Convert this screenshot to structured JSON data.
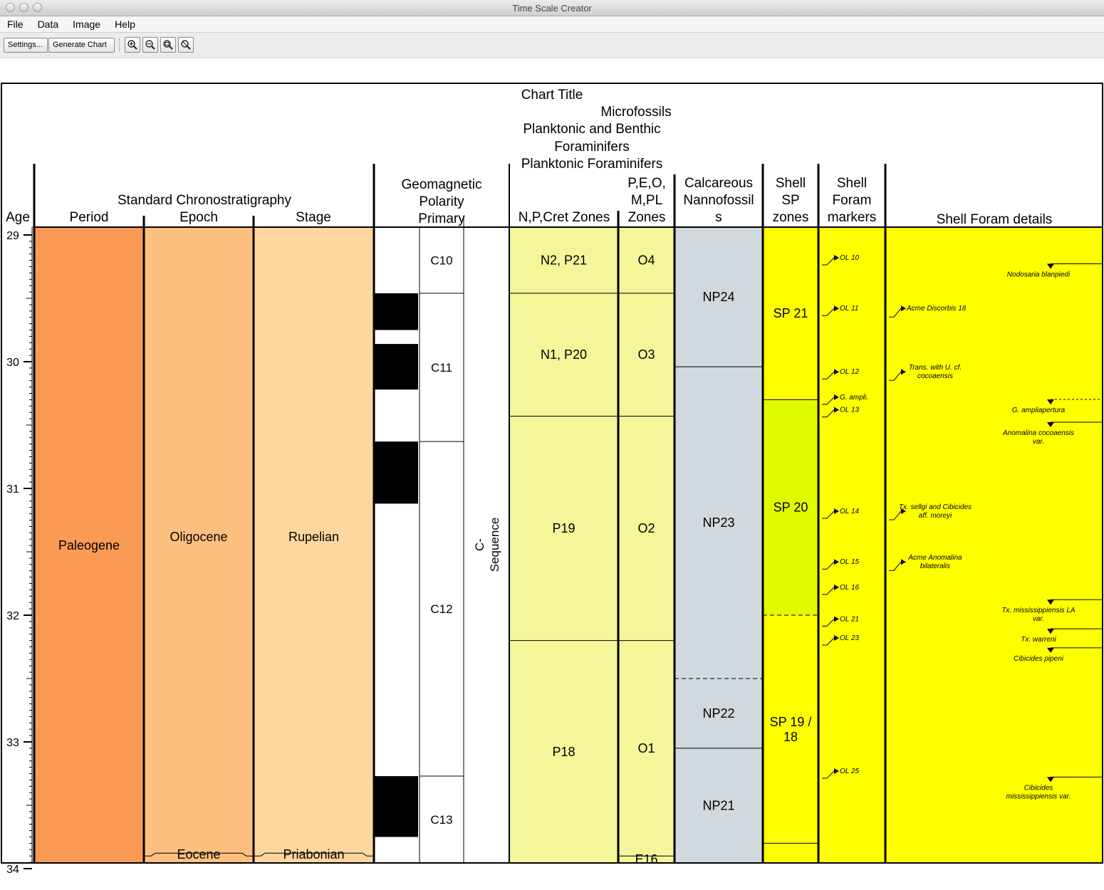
{
  "window": {
    "title": "Time Scale Creator"
  },
  "menu": {
    "items": [
      "File",
      "Data",
      "Image",
      "Help"
    ]
  },
  "toolbar": {
    "settings_label": "Settings...",
    "generate_label": "Generate Chart",
    "icons": [
      "zoom-in-icon",
      "zoom-out-icon",
      "zoom-actual-icon",
      "zoom-fit-icon"
    ]
  },
  "colors": {
    "period": "#FB9A55",
    "epoch": "#FDC07E",
    "stage": "#FDD79E",
    "zones": "#F5F59A",
    "nanno": "#D1D8DE",
    "shell": "#FFFF00",
    "sp20": "#E0FA00"
  },
  "chart_data": {
    "type": "table",
    "title": "Chart Title",
    "age_axis": {
      "label": "Age",
      "min": 29,
      "max": 34,
      "ticks": [
        29,
        30,
        31,
        32,
        33,
        34
      ]
    },
    "group_headers": {
      "chrono": "Standard Chronostratigraphy",
      "micro": "Microfossils",
      "forams": "Planktonic and Benthic Foraminifers",
      "plank": "Planktonic Foraminifers"
    },
    "columns": {
      "period": {
        "header": "Period",
        "units": [
          {
            "label": "Paleogene",
            "from": 28.9,
            "to": 34.07
          }
        ]
      },
      "epoch": {
        "header": "Epoch",
        "units": [
          {
            "label": "Oligocene",
            "from": 28.9,
            "to": 33.9
          },
          {
            "label": "Eocene",
            "from": 33.9,
            "to": 34.07
          }
        ]
      },
      "stage": {
        "header": "Stage",
        "units": [
          {
            "label": "Rupelian",
            "from": 28.9,
            "to": 33.9
          },
          {
            "label": "Priabonian",
            "from": 33.9,
            "to": 34.07
          }
        ]
      },
      "polarity": {
        "header": "Geomagnetic Polarity Primary",
        "black_intervals": [
          [
            29.46,
            29.75
          ],
          [
            29.86,
            30.22
          ],
          [
            30.63,
            31.12
          ],
          [
            33.27,
            33.75
          ]
        ],
        "chrons": [
          {
            "label": "C10",
            "from": 28.9,
            "to": 29.46
          },
          {
            "label": "C11",
            "from": 29.46,
            "to": 30.63
          },
          {
            "label": "C12",
            "from": 30.63,
            "to": 33.27
          },
          {
            "label": "C13",
            "from": 33.27,
            "to": 34.07
          }
        ],
        "sequence_label": "C-Sequence"
      },
      "npzones": {
        "header": "N,P,Cret Zones",
        "units": [
          {
            "label": "N2, P21",
            "from": 28.9,
            "to": 29.46
          },
          {
            "label": "N1, P20",
            "from": 29.46,
            "to": 30.43
          },
          {
            "label": "P19",
            "from": 30.43,
            "to": 32.2
          },
          {
            "label": "P18",
            "from": 32.2,
            "to": 34.07
          }
        ]
      },
      "pezones": {
        "header_lines": [
          "P,E,O,",
          "M,PL",
          "Zones"
        ],
        "units": [
          {
            "label": "O4",
            "from": 28.9,
            "to": 29.46
          },
          {
            "label": "O3",
            "from": 29.46,
            "to": 30.43
          },
          {
            "label": "O2",
            "from": 30.43,
            "to": 32.2
          },
          {
            "label": "O1",
            "from": 32.2,
            "to": 33.9
          },
          {
            "label": "E16",
            "from": 33.9,
            "to": 34.07
          }
        ]
      },
      "nanno": {
        "header_lines": [
          "Calcareous",
          "Nannofossil",
          "s"
        ],
        "units": [
          {
            "label": "NP24",
            "from": 28.9,
            "to": 30.04
          },
          {
            "label": "NP23",
            "from": 30.04,
            "to": 32.5,
            "dashed_bottom": true
          },
          {
            "label": "NP22",
            "from": 32.5,
            "to": 33.05
          },
          {
            "label": "NP21",
            "from": 33.05,
            "to": 34.07
          }
        ]
      },
      "shellsp": {
        "header_lines": [
          "Shell",
          "SP",
          "zones"
        ],
        "units": [
          {
            "label": "SP 21",
            "from": 28.9,
            "to": 30.3,
            "lines": [
              "SP 21"
            ]
          },
          {
            "label": "SP 20",
            "from": 30.3,
            "to": 32.0,
            "lines": [
              "SP 20"
            ],
            "highlight": true,
            "dashed_bottom": true
          },
          {
            "label": "SP 19 / 18",
            "from": 32.0,
            "to": 33.8,
            "lines": [
              "SP 19 /",
              "18"
            ]
          }
        ]
      },
      "markers": {
        "header_lines": [
          "Shell",
          "Foram",
          "markers"
        ],
        "events": [
          {
            "label": "OL 10",
            "age": 29.18
          },
          {
            "label": "OL 11",
            "age": 29.58
          },
          {
            "label": "OL 12",
            "age": 30.08
          },
          {
            "label": "G. ampli.",
            "age": 30.28
          },
          {
            "label": "OL 13",
            "age": 30.38
          },
          {
            "label": "OL 14",
            "age": 31.18
          },
          {
            "label": "OL 15",
            "age": 31.58
          },
          {
            "label": "OL 16",
            "age": 31.78
          },
          {
            "label": "OL 21",
            "age": 32.03
          },
          {
            "label": "OL 23",
            "age": 32.18
          },
          {
            "label": "OL 25",
            "age": 33.23
          }
        ]
      },
      "details": {
        "header": "Shell Foram details",
        "left_events": [
          {
            "lines": [
              "Acme Discorbis 18"
            ],
            "age": 29.58
          },
          {
            "lines": [
              "Trans. with U. cf.",
              "cocoaensis"
            ],
            "age": 30.08
          },
          {
            "lines": [
              "Tx. sellgi and Cibicides",
              "aff. moreyi"
            ],
            "age": 31.18
          },
          {
            "lines": [
              "Acme Anomalina",
              "bilateralis"
            ],
            "age": 31.58
          }
        ],
        "right_events": [
          {
            "lines": [
              "Nodosaria blanpiedi"
            ],
            "age": 29.25
          },
          {
            "lines": [
              "G. ampliapertura"
            ],
            "age": 30.32,
            "dashed": true
          },
          {
            "lines": [
              "Anomalina cocoaensis",
              "var."
            ],
            "age": 30.5
          },
          {
            "lines": [
              "Tx. mississippiensis LA",
              "var."
            ],
            "age": 31.9
          },
          {
            "lines": [
              "Tx. warreni"
            ],
            "age": 32.13
          },
          {
            "lines": [
              "Cibicides pipeni"
            ],
            "age": 32.28
          },
          {
            "lines": [
              "Cibicides",
              "mississippiensis var."
            ],
            "age": 33.3
          }
        ]
      }
    }
  }
}
